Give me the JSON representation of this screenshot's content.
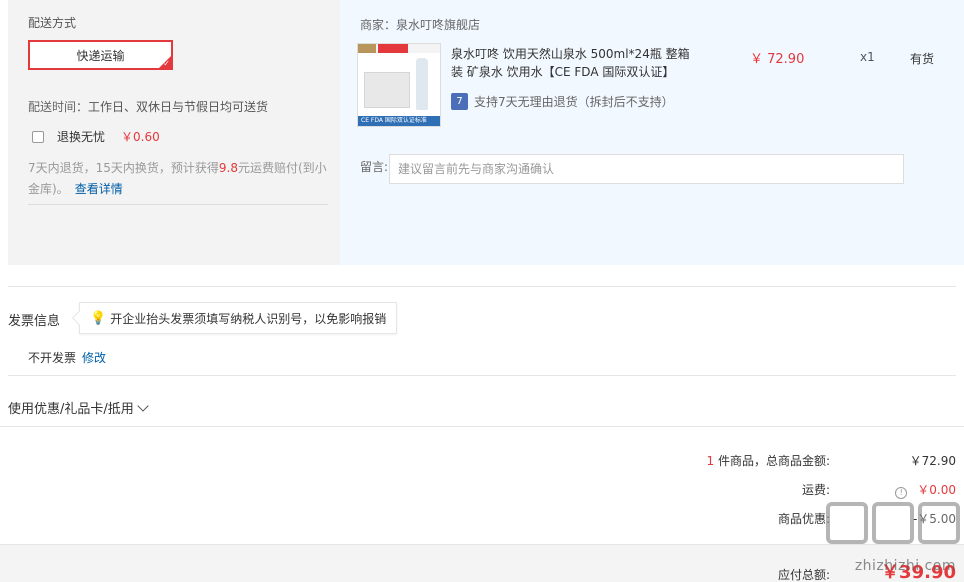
{
  "shipping": {
    "title": "配送方式",
    "method_label": "快递运输",
    "time_label": "配送时间：",
    "time_value": "工作日、双休日与节假日均可送货",
    "noworry_label": "退换无忧",
    "noworry_price": "￥0.60",
    "noworry_desc_1": "7天内退货，15天内换货，预计获得",
    "noworry_desc_num": "9.8",
    "noworry_desc_2": "元运费赔付(到小金库)。",
    "noworry_link": "查看详情"
  },
  "store": {
    "seller_label": "商家：",
    "seller_name": "泉水叮咚旗舰店",
    "product_title": "泉水叮咚 饮用天然山泉水 500ml*24瓶 整箱装 矿泉水 饮用水【CE FDA 国际双认证】",
    "product_price": "￥ 72.90",
    "product_qty": "x1",
    "product_stock": "有货",
    "return_icon_text": "7",
    "return_policy": "支持7天无理由退货（拆封后不支持）",
    "image_strip_text": "CE FDA 国际双认证标准",
    "memo_label": "留言:",
    "memo_placeholder": "建议留言前先与商家沟通确认"
  },
  "invoice": {
    "title": "发票信息",
    "tip": "开企业抬头发票须填写纳税人识别号，以免影响报销",
    "status": "不开发票",
    "edit_label": "修改"
  },
  "coupon": {
    "label": "使用优惠/礼品卡/抵用"
  },
  "summary": {
    "count": "1",
    "goods_label": "件商品，总商品金额:",
    "goods_value": "￥72.90",
    "freight_label": "运费:",
    "freight_value": "￥0.00",
    "discount_label": "商品优惠:",
    "discount_value": "-￥5.00",
    "payable_label": "应付总额:",
    "payable_value": "￥39.90"
  },
  "watermark": {
    "url": "zhizhizhi.com"
  },
  "colors": {
    "accent_red": "#e4393c",
    "link_blue": "#005ea7",
    "store_bg": "#f2f8ff",
    "shipping_bg": "#f3f3f3"
  }
}
